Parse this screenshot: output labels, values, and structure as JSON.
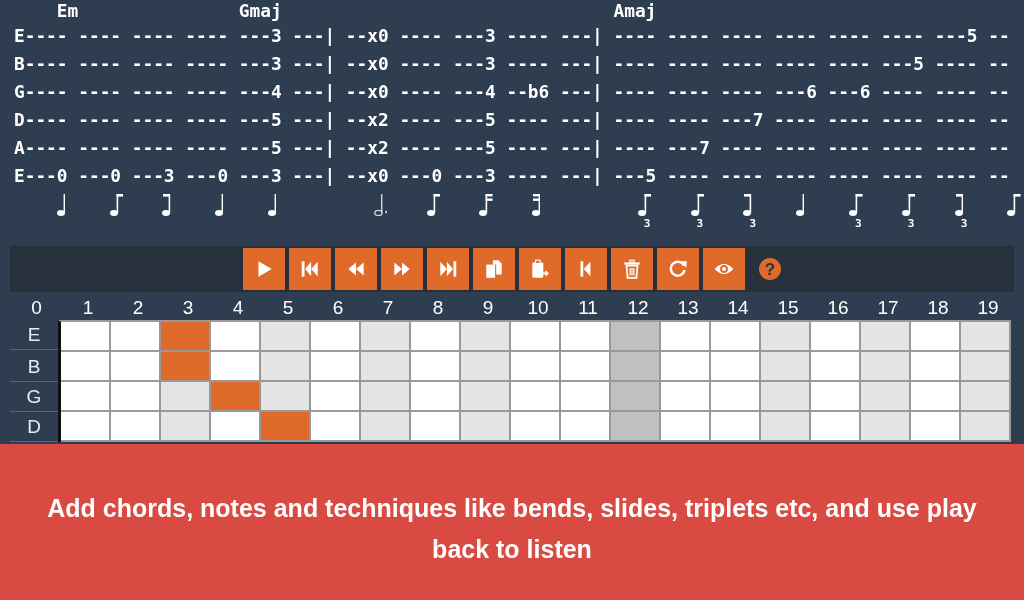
{
  "tablature": {
    "chord_line": "    Em               Gmaj                               Amaj",
    "lines": [
      "E---- ---- ---- ---- ---3 ---| --x0 ---- ---3 ---- ---| ---- ---- ---- ---- ---- ---- ---5 --",
      "B---- ---- ---- ---- ---3 ---| --x0 ---- ---3 ---- ---| ---- ---- ---- ---- ---- ---5 ---- --",
      "G---- ---- ---- ---- ---4 ---| --x0 ---- ---4 --b6 ---| ---- ---- ---- ---6 ---6 ---- ---- --",
      "D---- ---- ---- ---- ---5 ---| --x2 ---- ---5 ---- ---| ---- ---- ---7 ---- ---- ---- ---- --",
      "A---- ---- ---- ---- ---5 ---| --x2 ---- ---5 ---- ---| ---- ---7 ---- ---- ---- ---- ---- --",
      "E---0 ---0 ---3 ---0 ---3 ---| --x0 ---0 ---3 ---- ---| ---5 ---- ---- ---- ---- ---- ---- --"
    ],
    "measures": [
      {
        "notes": [
          {
            "kind": "quarter"
          },
          {
            "kind": "eighth-start"
          },
          {
            "kind": "eighth-end"
          },
          {
            "kind": "quarter"
          },
          {
            "kind": "quarter"
          }
        ]
      },
      {
        "notes": [
          {
            "kind": "dotted-half"
          },
          {
            "kind": "eighth-start"
          },
          {
            "kind": "sixteenth-start"
          },
          {
            "kind": "sixteenth-end"
          }
        ]
      },
      {
        "notes": [
          {
            "kind": "eighth-start",
            "tuplet": "3"
          },
          {
            "kind": "eighth-start",
            "tuplet": "3"
          },
          {
            "kind": "eighth-end",
            "tuplet": "3"
          },
          {
            "kind": "quarter"
          },
          {
            "kind": "eighth-start",
            "tuplet": "3"
          },
          {
            "kind": "eighth-start",
            "tuplet": "3"
          },
          {
            "kind": "eighth-end",
            "tuplet": "3"
          },
          {
            "kind": "eighth-start"
          }
        ]
      }
    ]
  },
  "transport_toolbar": {
    "buttons": [
      {
        "kind": "play"
      },
      {
        "kind": "skip-back"
      },
      {
        "kind": "rewind"
      },
      {
        "kind": "forward"
      },
      {
        "kind": "skip-forward"
      },
      {
        "kind": "copy"
      },
      {
        "kind": "paste"
      },
      {
        "kind": "step-back"
      },
      {
        "kind": "delete"
      },
      {
        "kind": "refresh"
      },
      {
        "kind": "view"
      }
    ],
    "help": "?"
  },
  "fretboard": {
    "open_label": "0",
    "frets": [
      {
        "label": "1",
        "kind": "plain"
      },
      {
        "label": "2",
        "kind": "plain"
      },
      {
        "label": "3",
        "kind": "marker"
      },
      {
        "label": "4",
        "kind": "plain"
      },
      {
        "label": "5",
        "kind": "marker"
      },
      {
        "label": "6",
        "kind": "plain"
      },
      {
        "label": "7",
        "kind": "marker"
      },
      {
        "label": "8",
        "kind": "plain"
      },
      {
        "label": "9",
        "kind": "marker"
      },
      {
        "label": "10",
        "kind": "plain"
      },
      {
        "label": "11",
        "kind": "plain"
      },
      {
        "label": "12",
        "kind": "octave"
      },
      {
        "label": "13",
        "kind": "plain"
      },
      {
        "label": "14",
        "kind": "plain"
      },
      {
        "label": "15",
        "kind": "marker"
      },
      {
        "label": "16",
        "kind": "plain"
      },
      {
        "label": "17",
        "kind": "marker"
      },
      {
        "label": "18",
        "kind": "plain"
      },
      {
        "label": "19",
        "kind": "marker"
      }
    ],
    "strings": [
      {
        "label": "E",
        "frets": [
          {
            "selected": false
          },
          {
            "selected": false
          },
          {
            "selected": true
          },
          {
            "selected": false
          },
          {
            "selected": false
          },
          {
            "selected": false
          },
          {
            "selected": false
          },
          {
            "selected": false
          },
          {
            "selected": false
          },
          {
            "selected": false
          },
          {
            "selected": false
          },
          {
            "selected": false
          },
          {
            "selected": false
          },
          {
            "selected": false
          },
          {
            "selected": false
          },
          {
            "selected": false
          },
          {
            "selected": false
          },
          {
            "selected": false
          },
          {
            "selected": false
          }
        ]
      },
      {
        "label": "B",
        "frets": [
          {
            "selected": false
          },
          {
            "selected": false
          },
          {
            "selected": true
          },
          {
            "selected": false
          },
          {
            "selected": false
          },
          {
            "selected": false
          },
          {
            "selected": false
          },
          {
            "selected": false
          },
          {
            "selected": false
          },
          {
            "selected": false
          },
          {
            "selected": false
          },
          {
            "selected": false
          },
          {
            "selected": false
          },
          {
            "selected": false
          },
          {
            "selected": false
          },
          {
            "selected": false
          },
          {
            "selected": false
          },
          {
            "selected": false
          },
          {
            "selected": false
          }
        ]
      },
      {
        "label": "G",
        "frets": [
          {
            "selected": false
          },
          {
            "selected": false
          },
          {
            "selected": false
          },
          {
            "selected": true
          },
          {
            "selected": false
          },
          {
            "selected": false
          },
          {
            "selected": false
          },
          {
            "selected": false
          },
          {
            "selected": false
          },
          {
            "selected": false
          },
          {
            "selected": false
          },
          {
            "selected": false
          },
          {
            "selected": false
          },
          {
            "selected": false
          },
          {
            "selected": false
          },
          {
            "selected": false
          },
          {
            "selected": false
          },
          {
            "selected": false
          },
          {
            "selected": false
          }
        ]
      },
      {
        "label": "D",
        "frets": [
          {
            "selected": false
          },
          {
            "selected": false
          },
          {
            "selected": false
          },
          {
            "selected": false
          },
          {
            "selected": true
          },
          {
            "selected": false
          },
          {
            "selected": false
          },
          {
            "selected": false
          },
          {
            "selected": false
          },
          {
            "selected": false
          },
          {
            "selected": false
          },
          {
            "selected": false
          },
          {
            "selected": false
          },
          {
            "selected": false
          },
          {
            "selected": false
          },
          {
            "selected": false
          },
          {
            "selected": false
          },
          {
            "selected": false
          },
          {
            "selected": false
          }
        ]
      }
    ]
  },
  "banner": {
    "text": "Add chords, notes and techniques like bends, slides, triplets etc, and use play back to listen"
  }
}
